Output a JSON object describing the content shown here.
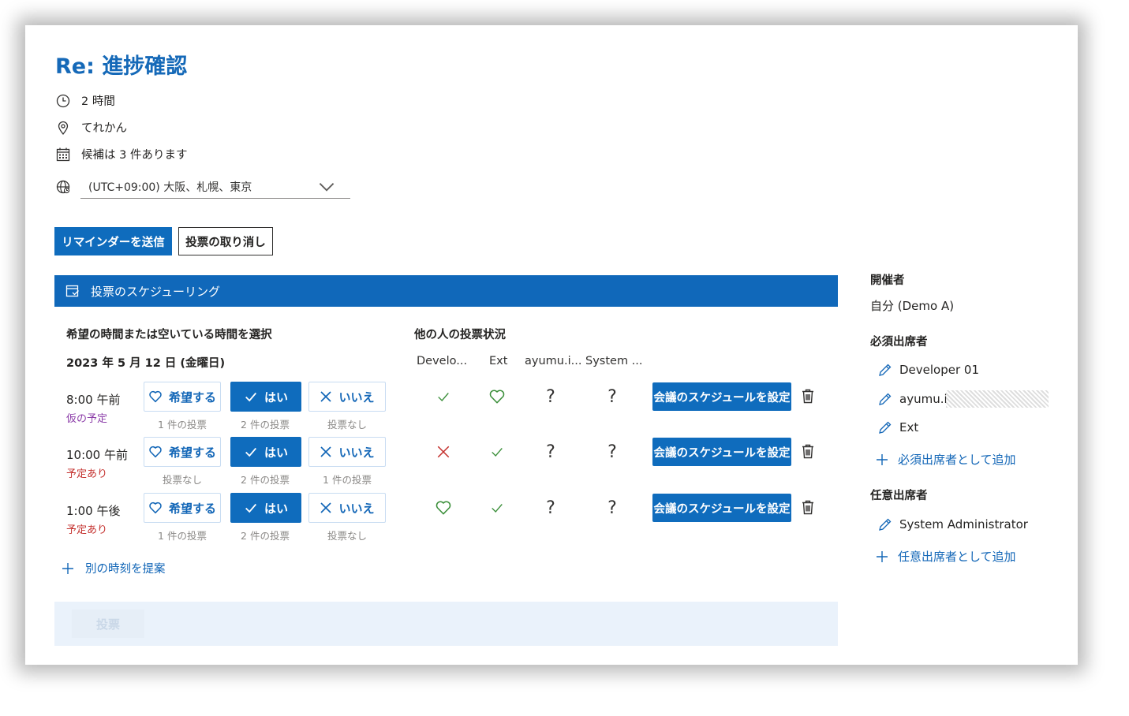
{
  "meeting": {
    "title": "Re: 進捗確認",
    "duration": "2 時間",
    "location": "てれかん",
    "candidates": "候補は 3 件あります",
    "timezone": "(UTC+09:00) 大阪、札幌、東京"
  },
  "actions": {
    "send_reminder": "リマインダーを送信",
    "cancel_poll": "投票の取り消し"
  },
  "banner": {
    "label": "投票のスケジューリング"
  },
  "left_section": {
    "heading": "希望の時間または空いている時間を選択",
    "date": "2023 年 5 月 12 日 (金曜日)"
  },
  "right_section": {
    "heading": "他の人の投票状況",
    "columns": [
      "Develo...",
      "Ext",
      "ayumu.i...",
      "System ..."
    ]
  },
  "vote_labels": {
    "prefer": "希望する",
    "yes": "はい",
    "no": "いいえ"
  },
  "schedule_button": "会議のスケジュールを設定",
  "slots": [
    {
      "time": "8:00 午前",
      "status": "仮の予定",
      "status_color": "#8b3ca8",
      "counts": [
        "1 件の投票",
        "2 件の投票",
        "投票なし"
      ],
      "marks": [
        "check",
        "heart",
        "question",
        "question"
      ]
    },
    {
      "time": "10:00 午前",
      "status": "予定あり",
      "status_color": "#c4312e",
      "counts": [
        "投票なし",
        "2 件の投票",
        "1 件の投票"
      ],
      "marks": [
        "cross",
        "check",
        "question",
        "question"
      ]
    },
    {
      "time": "1:00 午後",
      "status": "予定あり",
      "status_color": "#c4312e",
      "counts": [
        "1 件の投票",
        "2 件の投票",
        "投票なし"
      ],
      "marks": [
        "heart",
        "check",
        "question",
        "question"
      ]
    }
  ],
  "propose_time": "別の時刻を提案",
  "submit_vote": "投票",
  "sidebar": {
    "organizer_heading": "開催者",
    "organizer": "自分 (Demo A)",
    "required_heading": "必須出席者",
    "required": [
      "Developer 01",
      "ayumu.i",
      "Ext"
    ],
    "add_required": "必須出席者として追加",
    "optional_heading": "任意出席者",
    "optional": [
      "System Administrator"
    ],
    "add_optional": "任意出席者として追加"
  },
  "colors": {
    "accent": "#0f6cbd",
    "title": "#1569b8",
    "positive": "#3b8f3a",
    "negative": "#c4312e"
  }
}
